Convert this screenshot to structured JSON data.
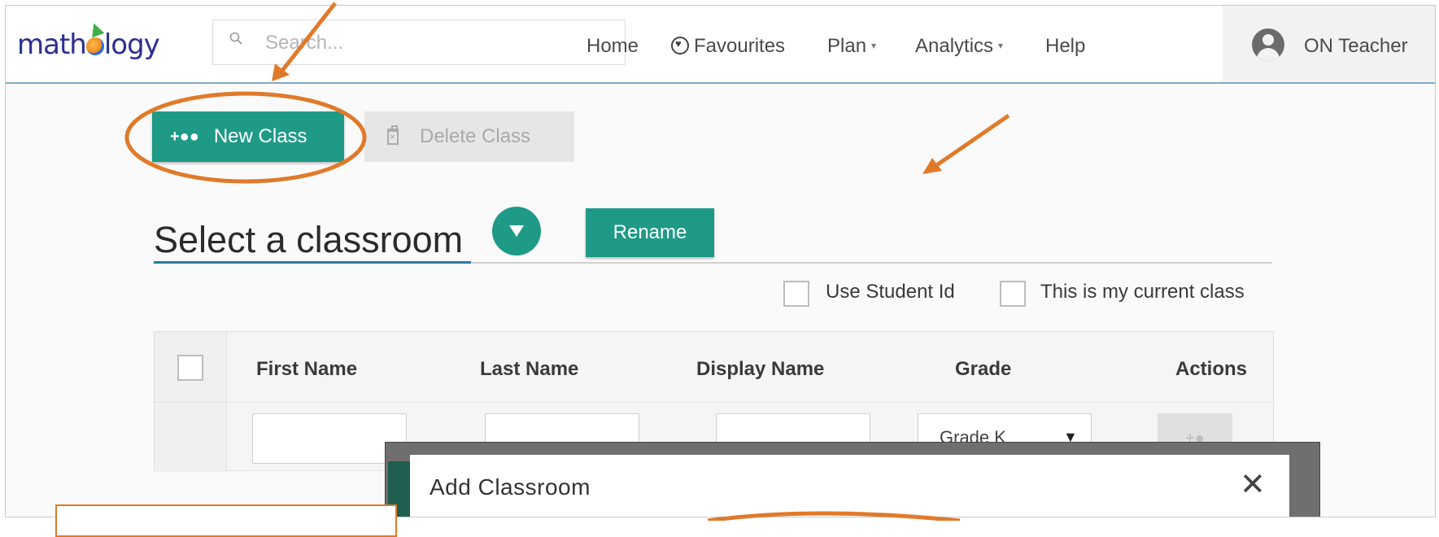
{
  "brand": {
    "logo_text_pre": "math",
    "logo_text_post": "logy"
  },
  "search": {
    "placeholder": "Search..."
  },
  "nav": {
    "home": "Home",
    "favourites": "Favourites",
    "plan": "Plan",
    "analytics": "Analytics",
    "help": "Help",
    "caret": "▾",
    "user_name": "ON Teacher"
  },
  "toolbar": {
    "new_class_label": "New Class",
    "new_class_icon": "add-group-icon",
    "delete_class_label": "Delete Class",
    "delete_class_icon": "trash-icon"
  },
  "classroom": {
    "heading": "Select a classroom",
    "rename_label": "Rename",
    "use_student_id_label": "Use Student Id",
    "current_class_label": "This is my current class"
  },
  "table": {
    "columns": [
      "First Name",
      "Last Name",
      "Display Name",
      "Grade",
      "Actions"
    ],
    "new_row": {
      "grade_value": "Grade K",
      "grade_arrow": "▼",
      "action_icon": "+●"
    }
  },
  "modal": {
    "title": "Add Classroom",
    "close_glyph": "✕"
  },
  "colors": {
    "accent": "#1f9a87",
    "annotation": "#e07a2a",
    "header_rule": "#7fa9c0",
    "disabled_button": "#e6e6e6"
  }
}
